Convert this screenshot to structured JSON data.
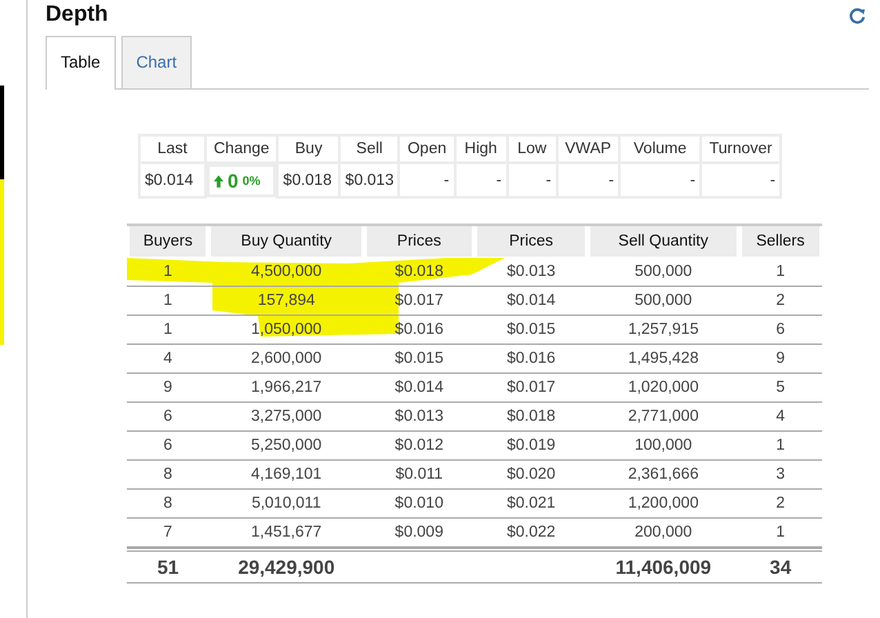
{
  "title": "Depth",
  "tabs": [
    {
      "label": "Table",
      "selected": true
    },
    {
      "label": "Chart",
      "selected": false
    }
  ],
  "summary": {
    "columns": [
      "Last",
      "Change",
      "Buy",
      "Sell",
      "Open",
      "High",
      "Low",
      "VWAP",
      "Volume",
      "Turnover"
    ],
    "last": "$0.014",
    "change": {
      "rising": true,
      "value": "0",
      "percent": "0%"
    },
    "values": [
      "$0.018",
      "$0.013",
      "-",
      "-",
      "-",
      "-",
      "-",
      "-"
    ]
  },
  "depth": {
    "columns": [
      "Buyers",
      "Buy Quantity",
      "Prices",
      "Prices",
      "Sell Quantity",
      "Sellers"
    ],
    "rows": [
      [
        "1",
        "4,500,000",
        "$0.018",
        "$0.013",
        "500,000",
        "1"
      ],
      [
        "1",
        "157,894",
        "$0.017",
        "$0.014",
        "500,000",
        "2"
      ],
      [
        "1",
        "1,050,000",
        "$0.016",
        "$0.015",
        "1,257,915",
        "6"
      ],
      [
        "4",
        "2,600,000",
        "$0.015",
        "$0.016",
        "1,495,428",
        "9"
      ],
      [
        "9",
        "1,966,217",
        "$0.014",
        "$0.017",
        "1,020,000",
        "5"
      ],
      [
        "6",
        "3,275,000",
        "$0.013",
        "$0.018",
        "2,771,000",
        "4"
      ],
      [
        "6",
        "5,250,000",
        "$0.012",
        "$0.019",
        "100,000",
        "1"
      ],
      [
        "8",
        "4,169,101",
        "$0.011",
        "$0.020",
        "2,361,666",
        "3"
      ],
      [
        "8",
        "5,010,011",
        "$0.010",
        "$0.021",
        "1,200,000",
        "2"
      ],
      [
        "7",
        "1,451,677",
        "$0.009",
        "$0.022",
        "200,000",
        "1"
      ]
    ],
    "totals": {
      "buyers": "51",
      "buy_quantity": "29,429,900",
      "sell_quantity": "11,406,009",
      "sellers": "34"
    }
  }
}
